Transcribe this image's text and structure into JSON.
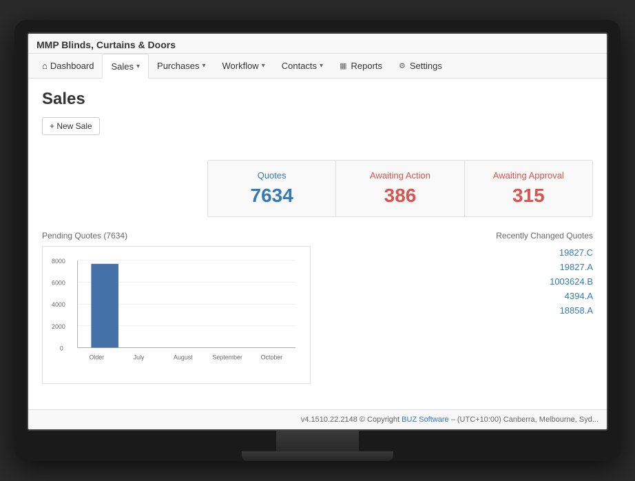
{
  "app": {
    "title": "MMP Blinds, Curtains & Doors"
  },
  "navbar": {
    "items": [
      {
        "id": "dashboard",
        "label": "Dashboard",
        "icon": "home",
        "active": false,
        "dropdown": false
      },
      {
        "id": "sales",
        "label": "Sales",
        "icon": null,
        "active": true,
        "dropdown": true
      },
      {
        "id": "purchases",
        "label": "Purchases",
        "icon": null,
        "active": false,
        "dropdown": true
      },
      {
        "id": "workflow",
        "label": "Workflow",
        "icon": null,
        "active": false,
        "dropdown": true
      },
      {
        "id": "contacts",
        "label": "Contacts",
        "icon": null,
        "active": false,
        "dropdown": true
      },
      {
        "id": "reports",
        "label": "Reports",
        "icon": "bar-chart",
        "active": false,
        "dropdown": false
      },
      {
        "id": "settings",
        "label": "Settings",
        "icon": "gear",
        "active": false,
        "dropdown": false
      }
    ]
  },
  "page": {
    "title": "Sales",
    "new_button_label": "+ New Sale"
  },
  "stats": {
    "quotes": {
      "label": "Quotes",
      "value": "7634"
    },
    "awaiting_action": {
      "label": "Awaiting Action",
      "value": "386"
    },
    "awaiting_approval": {
      "label": "Awaiting Approval",
      "value": "315"
    }
  },
  "chart": {
    "title": "Pending Quotes (7634)",
    "y_labels": [
      "8000",
      "6000",
      "4000",
      "2000",
      "0"
    ],
    "x_labels": [
      "Older",
      "July",
      "August",
      "September",
      "October"
    ],
    "bars": [
      {
        "label": "Older",
        "value": 7634,
        "height_pct": 92
      },
      {
        "label": "July",
        "value": 0,
        "height_pct": 0
      },
      {
        "label": "August",
        "value": 0,
        "height_pct": 0
      },
      {
        "label": "September",
        "value": 0,
        "height_pct": 0
      },
      {
        "label": "October",
        "value": 0,
        "height_pct": 0
      }
    ]
  },
  "recently_changed": {
    "title": "Recently Changed Quotes",
    "items": [
      {
        "id": "19827.C",
        "label": "19827.C"
      },
      {
        "id": "19827.A",
        "label": "19827.A"
      },
      {
        "id": "1003624.B",
        "label": "1003624.B"
      },
      {
        "id": "4394.A",
        "label": "4394.A"
      },
      {
        "id": "18858.A",
        "label": "18858.A"
      }
    ]
  },
  "footer": {
    "text": "v4.1510.22.2148 © Copyright ",
    "link_text": "BUZ Software",
    "timezone": " – (UTC+10:00) Canberra, Melbourne, Syd..."
  }
}
